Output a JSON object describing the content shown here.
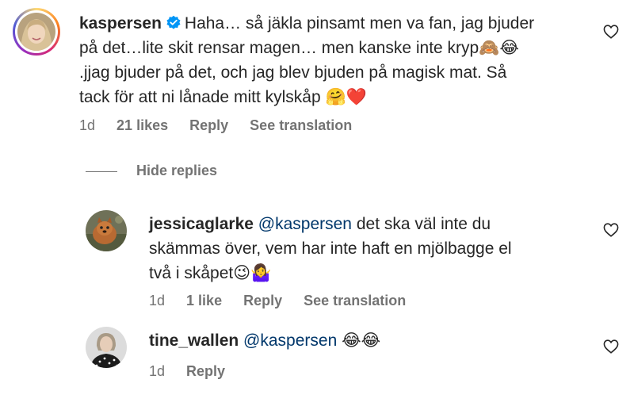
{
  "comments": [
    {
      "username": "kaspersen",
      "verified": true,
      "text_lines": [
        "Haha… så jäkla pinsamt men va fan, jag bjuder",
        "på det…lite skit rensar magen… men kanske inte kryp🙈😂",
        ".jjag bjuder på det, och jag blev bjuden på magisk mat. Så",
        "tack för att ni lånade mitt kylskåp 🤗❤️"
      ],
      "time": "1d",
      "likes": "21 likes",
      "reply_label": "Reply",
      "translate_label": "See translation"
    }
  ],
  "hide_replies_label": "Hide replies",
  "replies": [
    {
      "username": "jessicaglarke",
      "mention": "@kaspersen",
      "text_lines": [
        "det ska väl inte du",
        "skämmas över, vem har inte haft en mjölbagge el",
        "två i skåpet😉🤷‍♀️"
      ],
      "time": "1d",
      "likes": "1 like",
      "reply_label": "Reply",
      "translate_label": "See translation"
    },
    {
      "username": "tine_wallen",
      "mention": "@kaspersen",
      "emoji_text": "😂😂",
      "time": "1d",
      "reply_label": "Reply"
    }
  ],
  "colors": {
    "text": "#262626",
    "secondary": "#737373",
    "mention": "#00376b",
    "verified": "#0095f6"
  }
}
